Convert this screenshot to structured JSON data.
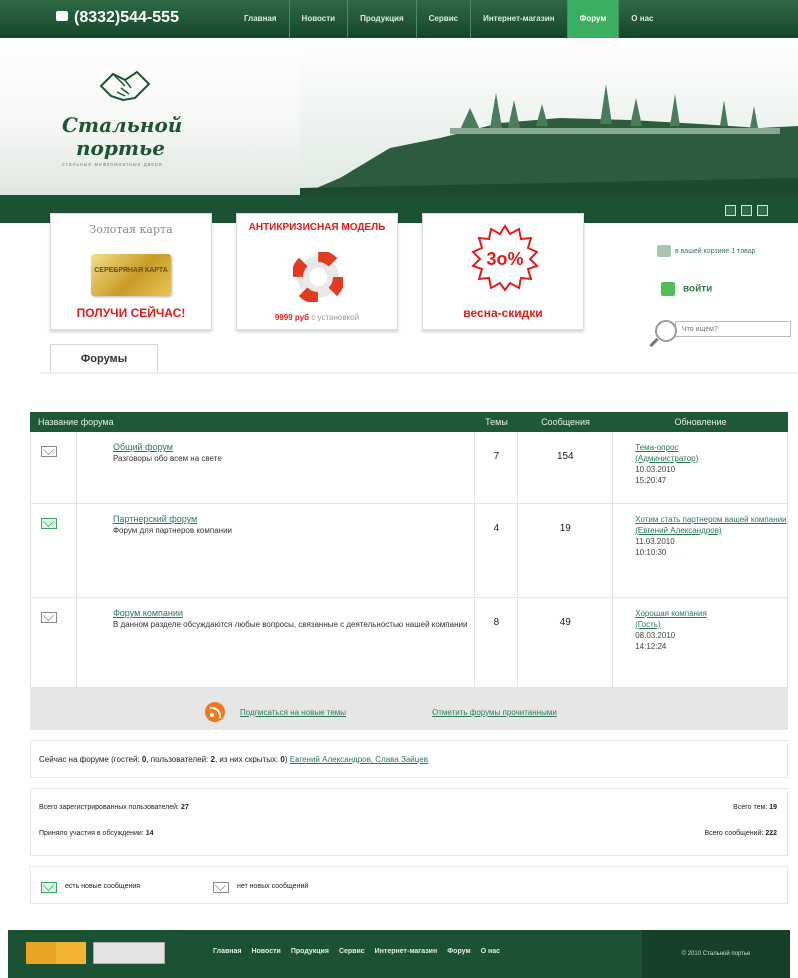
{
  "header": {
    "phone": "(8332)544-555",
    "nav": [
      {
        "label": "Главная",
        "active": false
      },
      {
        "label": "Новости",
        "active": false
      },
      {
        "label": "Продукция",
        "active": false
      },
      {
        "label": "Сервис",
        "active": false
      },
      {
        "label": "Интернет-магазин",
        "active": false
      },
      {
        "label": "Форум",
        "active": true
      },
      {
        "label": "О нас",
        "active": false
      }
    ]
  },
  "logo": {
    "line1": "Стальной",
    "line2": "портье",
    "tagline": "стальные межкомнатные двери"
  },
  "promos": [
    {
      "title": "Золотая карта",
      "card_text": "СЕРЕБРЯНАЯ КАРТА",
      "cta": "ПОЛУЧИ СЕЙЧАС!"
    },
    {
      "title": "АНТИКРИЗИСНАЯ МОДЕЛЬ",
      "price": "9999 руб",
      "price_note": "с установкой"
    },
    {
      "title": "3о%",
      "cta": "весна-скидки"
    }
  ],
  "sidebar": {
    "cart_text": "в вашей корзине 1 товар",
    "login": "войти",
    "search_placeholder": "Что ищем?"
  },
  "tab": {
    "label": "Форумы"
  },
  "forum_table": {
    "headers": {
      "name": "Название форума",
      "topics": "Темы",
      "messages": "Сообщения",
      "updated": "Обновление"
    },
    "rows": [
      {
        "title": "Общий форум",
        "desc": "Разговоры обо всем на свете",
        "topics": "7",
        "messages": "154",
        "last_topic": "Тема-опрос",
        "author": "(Администратор)",
        "date": "10.03.2010",
        "time": "15:20:47",
        "new": false
      },
      {
        "title": "Партнерский форум",
        "desc": "Форум для партнеров компании",
        "topics": "4",
        "messages": "19",
        "last_topic": "Хотим стать партнером вашей компании",
        "author": "(Евгений Александров)",
        "date": "11.03.2010",
        "time": "10:10:30",
        "new": true
      },
      {
        "title": "Форум компании",
        "desc": "В данном разделе обсуждаются любые вопросы, связанные с деятельностью нашей компании",
        "topics": "8",
        "messages": "49",
        "last_topic": "Хорошая компания",
        "author": "(Гость)",
        "date": "08.03.2010",
        "time": "14:12:24",
        "new": false
      }
    ]
  },
  "subscribe": {
    "rss_link": "Подписаться на новые темы",
    "mark_read": "Отметить форумы прочитанными"
  },
  "online": {
    "prefix": "Сейчас на форуме (гостей: ",
    "guests": "0",
    "mid1": ", пользователей: ",
    "users": "2",
    "mid2": ", из них скрытых: ",
    "hidden": "0",
    "mid3": ") ",
    "names": "Евгений Александров, Слава Зайцев"
  },
  "stats": {
    "registered_label": "Всего зарегистрированных пользователей:",
    "registered": "27",
    "participated_label": "Приняло участия в обсуждении:",
    "participated": "14",
    "topics_label": "Всего тем:",
    "topics": "19",
    "messages_label": "Всего сообщений:",
    "messages": "222"
  },
  "legend": {
    "new": "есть новые сообщения",
    "none": "нет новых сообщений"
  },
  "footer": {
    "nav": [
      "Главная",
      "Новости",
      "Продукция",
      "Сервис",
      "Интернет-магазин",
      "Форум",
      "О нас"
    ],
    "copyright": "© 2010 Стальной портье"
  }
}
